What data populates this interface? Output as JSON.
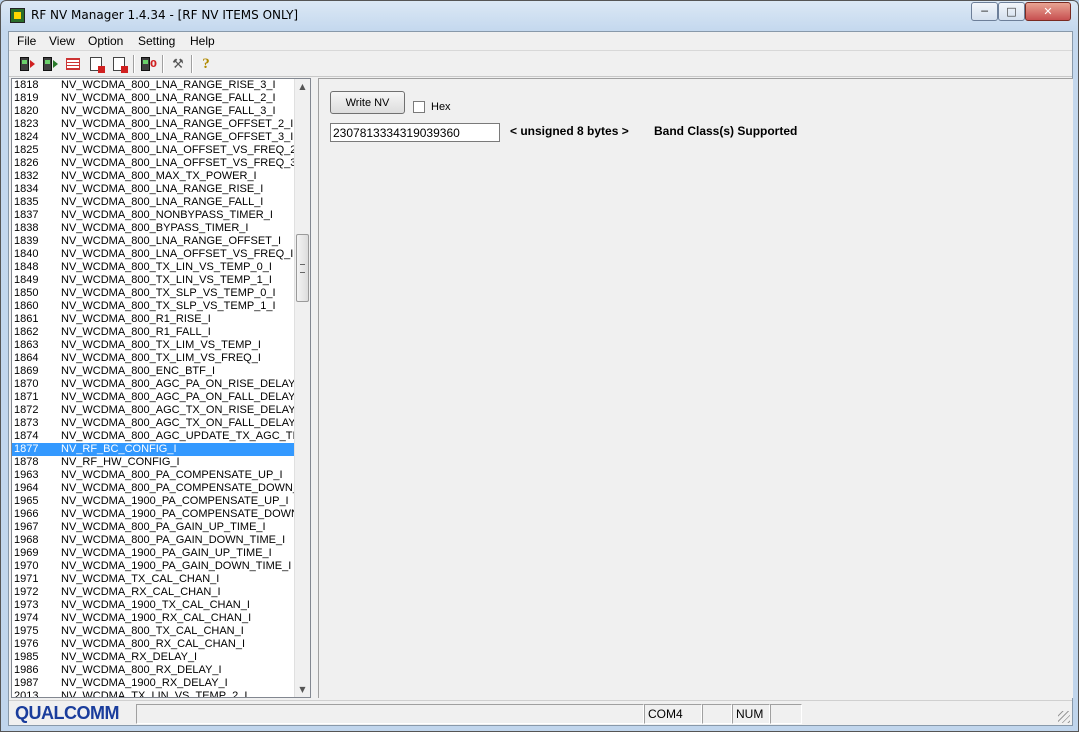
{
  "window": {
    "title": "RF NV Manager 1.4.34 - [RF NV ITEMS ONLY]",
    "min_glyph": "─",
    "max_glyph": "□",
    "close_glyph": "✕"
  },
  "menu": [
    "File",
    "View",
    "Option",
    "Setting",
    "Help"
  ],
  "toolbar": {
    "icons": [
      "read-phone-icon",
      "write-phone-icon",
      "nv-grid-icon",
      "export-doc-icon",
      "import-doc-icon",
      "phone-connect-icon",
      "tool-icon",
      "help-icon"
    ],
    "help_glyph": "?",
    "tool_glyph": "⚒"
  },
  "nv_list": [
    {
      "num": "1818",
      "name": "NV_WCDMA_800_LNA_RANGE_RISE_3_I"
    },
    {
      "num": "1819",
      "name": "NV_WCDMA_800_LNA_RANGE_FALL_2_I"
    },
    {
      "num": "1820",
      "name": "NV_WCDMA_800_LNA_RANGE_FALL_3_I"
    },
    {
      "num": "1823",
      "name": "NV_WCDMA_800_LNA_RANGE_OFFSET_2_I"
    },
    {
      "num": "1824",
      "name": "NV_WCDMA_800_LNA_RANGE_OFFSET_3_I"
    },
    {
      "num": "1825",
      "name": "NV_WCDMA_800_LNA_OFFSET_VS_FREQ_2_"
    },
    {
      "num": "1826",
      "name": "NV_WCDMA_800_LNA_OFFSET_VS_FREQ_3_"
    },
    {
      "num": "1832",
      "name": "NV_WCDMA_800_MAX_TX_POWER_I"
    },
    {
      "num": "1834",
      "name": "NV_WCDMA_800_LNA_RANGE_RISE_I"
    },
    {
      "num": "1835",
      "name": "NV_WCDMA_800_LNA_RANGE_FALL_I"
    },
    {
      "num": "1837",
      "name": "NV_WCDMA_800_NONBYPASS_TIMER_I"
    },
    {
      "num": "1838",
      "name": "NV_WCDMA_800_BYPASS_TIMER_I"
    },
    {
      "num": "1839",
      "name": "NV_WCDMA_800_LNA_RANGE_OFFSET_I"
    },
    {
      "num": "1840",
      "name": "NV_WCDMA_800_LNA_OFFSET_VS_FREQ_I"
    },
    {
      "num": "1848",
      "name": "NV_WCDMA_800_TX_LIN_VS_TEMP_0_I"
    },
    {
      "num": "1849",
      "name": "NV_WCDMA_800_TX_LIN_VS_TEMP_1_I"
    },
    {
      "num": "1850",
      "name": "NV_WCDMA_800_TX_SLP_VS_TEMP_0_I"
    },
    {
      "num": "1860",
      "name": "NV_WCDMA_800_TX_SLP_VS_TEMP_1_I"
    },
    {
      "num": "1861",
      "name": "NV_WCDMA_800_R1_RISE_I"
    },
    {
      "num": "1862",
      "name": "NV_WCDMA_800_R1_FALL_I"
    },
    {
      "num": "1863",
      "name": "NV_WCDMA_800_TX_LIM_VS_TEMP_I"
    },
    {
      "num": "1864",
      "name": "NV_WCDMA_800_TX_LIM_VS_FREQ_I"
    },
    {
      "num": "1869",
      "name": "NV_WCDMA_800_ENC_BTF_I"
    },
    {
      "num": "1870",
      "name": "NV_WCDMA_800_AGC_PA_ON_RISE_DELAY_"
    },
    {
      "num": "1871",
      "name": "NV_WCDMA_800_AGC_PA_ON_FALL_DELAY_"
    },
    {
      "num": "1872",
      "name": "NV_WCDMA_800_AGC_TX_ON_RISE_DELAY_"
    },
    {
      "num": "1873",
      "name": "NV_WCDMA_800_AGC_TX_ON_FALL_DELAY_"
    },
    {
      "num": "1874",
      "name": "NV_WCDMA_800_AGC_UPDATE_TX_AGC_TIM"
    },
    {
      "num": "1877",
      "name": "NV_RF_BC_CONFIG_I",
      "selected": true
    },
    {
      "num": "1878",
      "name": "NV_RF_HW_CONFIG_I"
    },
    {
      "num": "1963",
      "name": "NV_WCDMA_800_PA_COMPENSATE_UP_I"
    },
    {
      "num": "1964",
      "name": "NV_WCDMA_800_PA_COMPENSATE_DOWN_"
    },
    {
      "num": "1965",
      "name": "NV_WCDMA_1900_PA_COMPENSATE_UP_I"
    },
    {
      "num": "1966",
      "name": "NV_WCDMA_1900_PA_COMPENSATE_DOWN"
    },
    {
      "num": "1967",
      "name": "NV_WCDMA_800_PA_GAIN_UP_TIME_I"
    },
    {
      "num": "1968",
      "name": "NV_WCDMA_800_PA_GAIN_DOWN_TIME_I"
    },
    {
      "num": "1969",
      "name": "NV_WCDMA_1900_PA_GAIN_UP_TIME_I"
    },
    {
      "num": "1970",
      "name": "NV_WCDMA_1900_PA_GAIN_DOWN_TIME_I"
    },
    {
      "num": "1971",
      "name": "NV_WCDMA_TX_CAL_CHAN_I"
    },
    {
      "num": "1972",
      "name": "NV_WCDMA_RX_CAL_CHAN_I"
    },
    {
      "num": "1973",
      "name": "NV_WCDMA_1900_TX_CAL_CHAN_I"
    },
    {
      "num": "1974",
      "name": "NV_WCDMA_1900_RX_CAL_CHAN_I"
    },
    {
      "num": "1975",
      "name": "NV_WCDMA_800_TX_CAL_CHAN_I"
    },
    {
      "num": "1976",
      "name": "NV_WCDMA_800_RX_CAL_CHAN_I"
    },
    {
      "num": "1985",
      "name": "NV_WCDMA_RX_DELAY_I"
    },
    {
      "num": "1986",
      "name": "NV_WCDMA_800_RX_DELAY_I"
    },
    {
      "num": "1987",
      "name": "NV_WCDMA_1900_RX_DELAY_I"
    },
    {
      "num": "2013",
      "name": "NV_WCDMA_TX_LIN_VS_TEMP_2_I"
    }
  ],
  "editor": {
    "write_button": "Write NV",
    "hex_label": "Hex",
    "hex_checked": false,
    "value": "2307813334319039360",
    "type_label": "< unsigned 8 bytes >",
    "description": "Band Class(s) Supported"
  },
  "status": {
    "logo": "QUALCOMM",
    "port": "COM4",
    "numlock": "NUM"
  },
  "colors": {
    "selection": "#3399ff",
    "logo": "#1a3d9c"
  }
}
